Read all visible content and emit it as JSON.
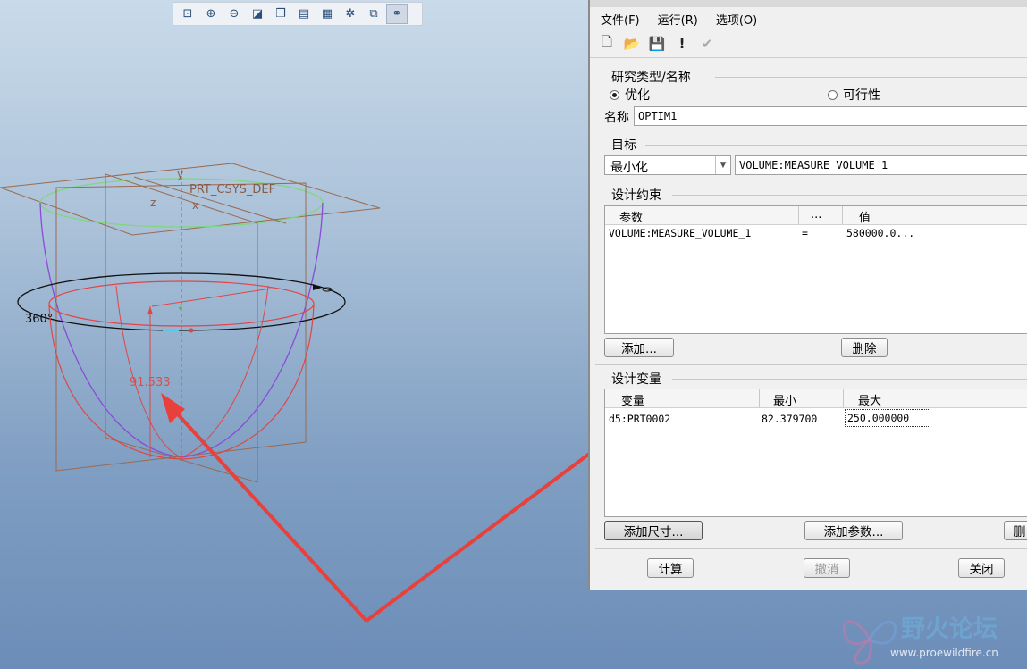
{
  "toolbar": {
    "icons": [
      "zoom-fit-icon",
      "zoom-in-icon",
      "zoom-out-icon",
      "repaint-icon",
      "view-orientation-icon",
      "saved-views-icon",
      "display-style-icon",
      "datum-display-icon",
      "spin-center-icon",
      "annotation-display-icon"
    ]
  },
  "model": {
    "csys_label": "PRT_CSYS_DEF",
    "axis_y": "y",
    "axis_z": "z",
    "axis_x": "x",
    "angle_label": "360°",
    "dim_label": "91.533"
  },
  "dialog": {
    "menu": {
      "file": "文件(F)",
      "run": "运行(R)",
      "options": "选项(O)"
    },
    "study": {
      "title": "研究类型/名称",
      "opt_optimize": "优化",
      "opt_feasibility": "可行性",
      "name_label": "名称",
      "name_value": "OPTIM1"
    },
    "goal": {
      "title": "目标",
      "mode": "最小化",
      "parameter": "VOLUME:MEASURE_VOLUME_1"
    },
    "constraints": {
      "title": "设计约束",
      "headers": [
        "参数",
        "...",
        "值"
      ],
      "rows": [
        {
          "param": "VOLUME:MEASURE_VOLUME_1",
          "op": "=",
          "value": "580000.0..."
        }
      ],
      "add_button": "添加...",
      "delete_button": "删除"
    },
    "variables": {
      "title": "设计变量",
      "headers": [
        "变量",
        "最小",
        "最大"
      ],
      "rows": [
        {
          "var": "d5:PRT0002",
          "min": "82.379700",
          "max": "250.000000"
        }
      ],
      "add_dim_button": "添加尺寸...",
      "add_param_button": "添加参数...",
      "delete_button_partial": "删"
    },
    "footer": {
      "compute": "计算",
      "cancel": "撤消",
      "close": "关闭"
    }
  },
  "watermark": {
    "text": "野火论坛",
    "url": "www.proewildfire.cn"
  },
  "colors": {
    "annotation_arrow": "#e8403a",
    "dimension_text": "#d65050",
    "highlight_green": "#7fd67f",
    "sketch_purple": "#8a4bd8"
  }
}
